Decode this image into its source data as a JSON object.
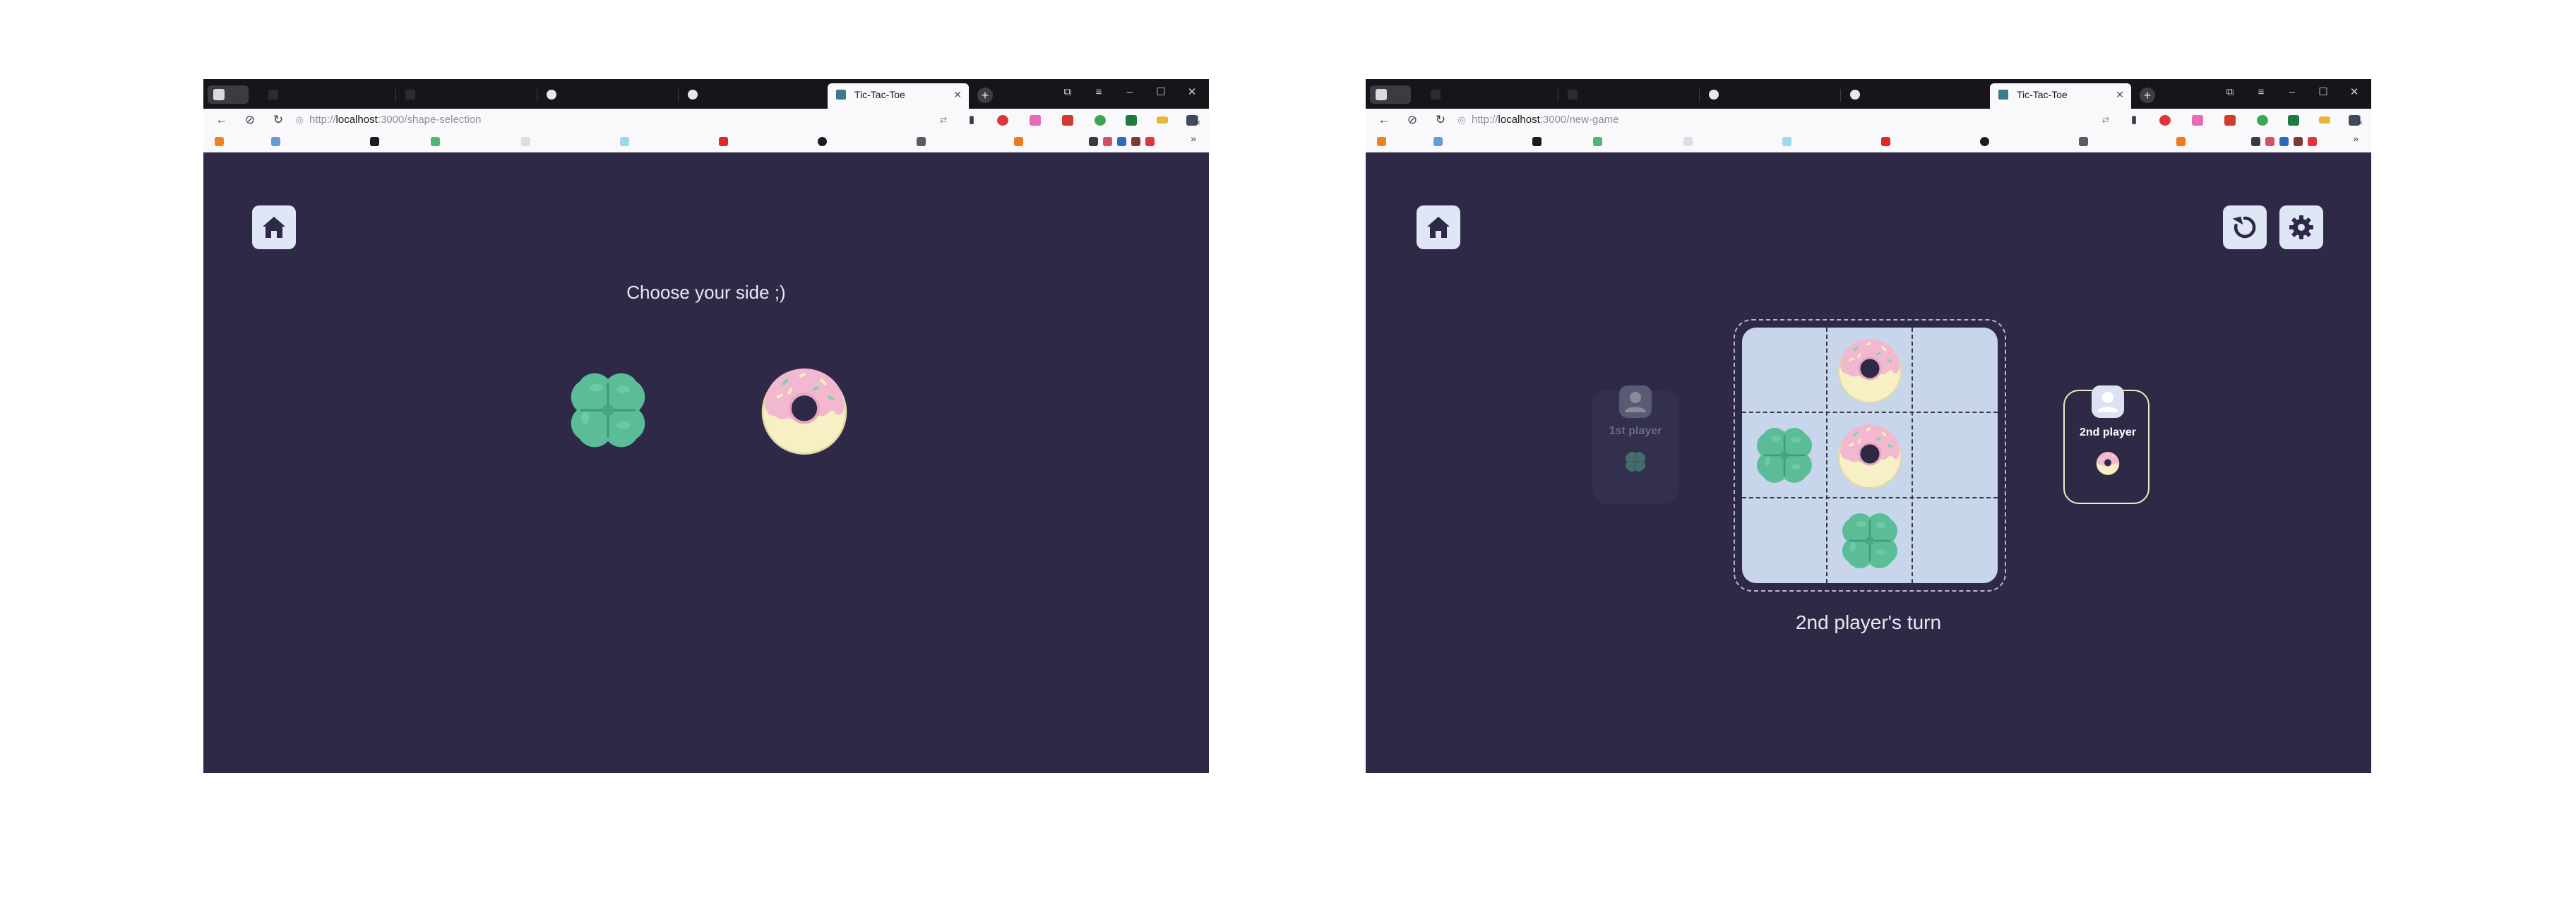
{
  "left": {
    "tabs": [
      {
        "title": "",
        "kind": "blur"
      },
      {
        "title": "",
        "kind": "blur"
      },
      {
        "title": "",
        "kind": "gh-blur"
      },
      {
        "title": "",
        "kind": "gh-blur"
      },
      {
        "title": "Tic-Tac-Toe",
        "kind": "active"
      }
    ],
    "url": {
      "prefix": "http://",
      "host": "localhost",
      "rest": ":3000/shape-selection"
    },
    "prompt": "Choose your side ;)",
    "choices": [
      "clover-piece",
      "donut-piece"
    ]
  },
  "right": {
    "tabs": [
      {
        "title": "",
        "kind": "blur"
      },
      {
        "title": "",
        "kind": "blur"
      },
      {
        "title": "",
        "kind": "gh-blur"
      },
      {
        "title": "",
        "kind": "gh-blur"
      },
      {
        "title": "Tic-Tac-Toe",
        "kind": "active"
      }
    ],
    "url": {
      "prefix": "http://",
      "host": "localhost",
      "rest": ":3000/new-game"
    },
    "players": [
      {
        "name": "1st player",
        "piece": "clover",
        "active": false
      },
      {
        "name": "2nd player",
        "piece": "donut",
        "active": true
      }
    ],
    "board": [
      [
        "",
        "donut",
        ""
      ],
      [
        "clover",
        "donut",
        ""
      ],
      [
        "",
        "clover",
        ""
      ]
    ],
    "status": "2nd player's turn"
  },
  "icons": {
    "home": "home-icon",
    "restart": "restart-icon",
    "settings": "settings-icon",
    "clover": "clover-icon",
    "donut": "donut-icon",
    "avatar": "user-avatar-icon"
  },
  "colors": {
    "app_bg": "#2d2946",
    "board_bg": "#c8d6ec",
    "button_bg": "#dfe6f6",
    "active_player_border": "#f2ecc4",
    "clover": "#5bbd97",
    "donut_icing": "#f2b8cf",
    "donut_dough": "#f7f0c4"
  }
}
